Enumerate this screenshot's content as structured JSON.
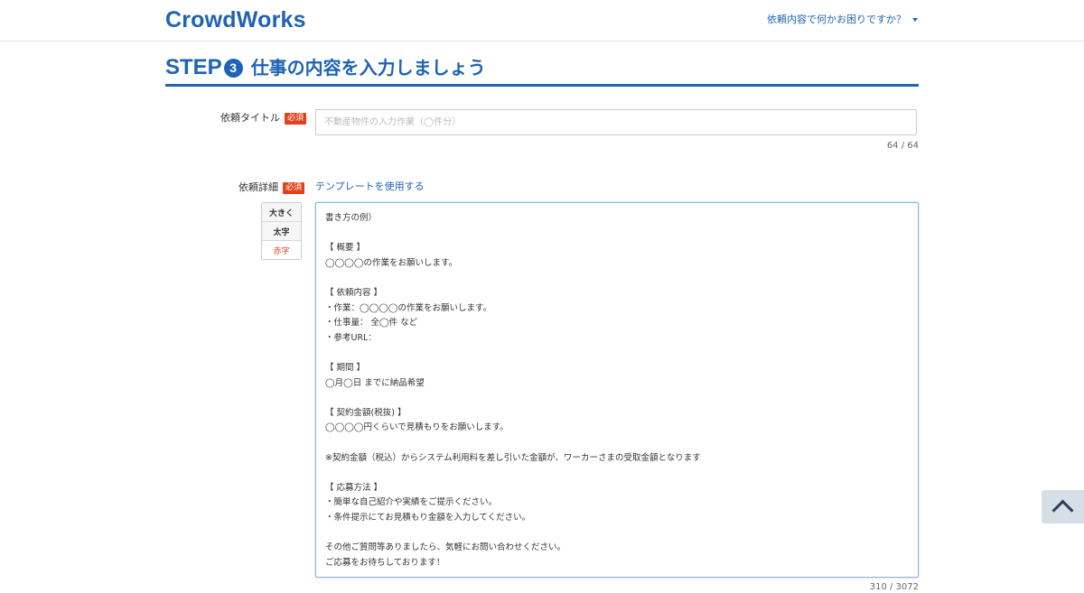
{
  "header": {
    "logo_text": "CrowdWorks",
    "help_menu_label": "依頼内容で何かお困りですか？"
  },
  "step": {
    "label": "STEP",
    "number": "3",
    "title": "仕事の内容を入力しましょう"
  },
  "title_field": {
    "label": "依頼タイトル",
    "required_badge": "必須",
    "placeholder": "不動産物件の入力作業（◯件分）",
    "value": "",
    "counter": "64 / 64"
  },
  "detail_field": {
    "label": "依頼詳細",
    "required_badge": "必須",
    "template_link": "テンプレートを使用する",
    "toolbar": {
      "large_label": "大きく",
      "bold_label": "太字",
      "red_label": "赤字"
    },
    "value": "書き方の例）\n\n【 概要 】\n◯◯◯◯の作業をお願いします。\n\n【 依頼内容 】\n・作業：◯◯◯◯の作業をお願いします。\n・仕事量： 全◯件 など\n・参考URL：\n\n【 期間 】\n◯月◯日 までに納品希望\n\n【 契約金額(税抜) 】\n◯◯◯◯円くらいで見積もりをお願いします。\n\n※契約金額（税込）からシステム利用料を差し引いた金額が、ワーカーさまの受取金額となります\n\n【 応募方法 】\n・簡単な自己紹介や実績をご提示ください。\n・条件提示にてお見積もり金額を入力してください。\n\nその他ご質問等ありましたら、気軽にお問い合わせください。\nご応募をお待ちしております！",
    "counter": "310 / 3072"
  },
  "colors": {
    "brand": "#1e63b5",
    "required": "#e2411d"
  },
  "icons": {
    "help_menu": "caret-down-icon",
    "scroll_top": "chevron-up-icon"
  }
}
